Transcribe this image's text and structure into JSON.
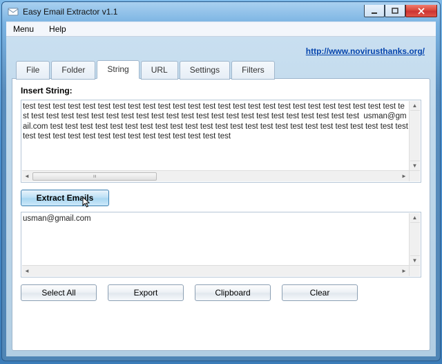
{
  "window": {
    "title": "Easy Email Extractor v1.1"
  },
  "menubar": {
    "items": [
      "Menu",
      "Help"
    ]
  },
  "header": {
    "link_text": "http://www.novirusthanks.org/"
  },
  "tabs": {
    "items": [
      "File",
      "Folder",
      "String",
      "URL",
      "Settings",
      "Filters"
    ],
    "active_index": 2
  },
  "string_tab": {
    "insert_label": "Insert String:",
    "input_text": "test test test test test test test test test test test test test test test test test test test test test test test test test test test test test test test test test test test test test test test test test test test test test test test test  usman@gmail.com test test test test test test test test test test test test test test test test test test test test test test test test test test test test test test test test test test test test test test",
    "extract_button": "Extract Emails",
    "results_text": "usman@gmail.com"
  },
  "bottom_buttons": {
    "select_all": "Select All",
    "export": "Export",
    "clipboard": "Clipboard",
    "clear": "Clear"
  }
}
